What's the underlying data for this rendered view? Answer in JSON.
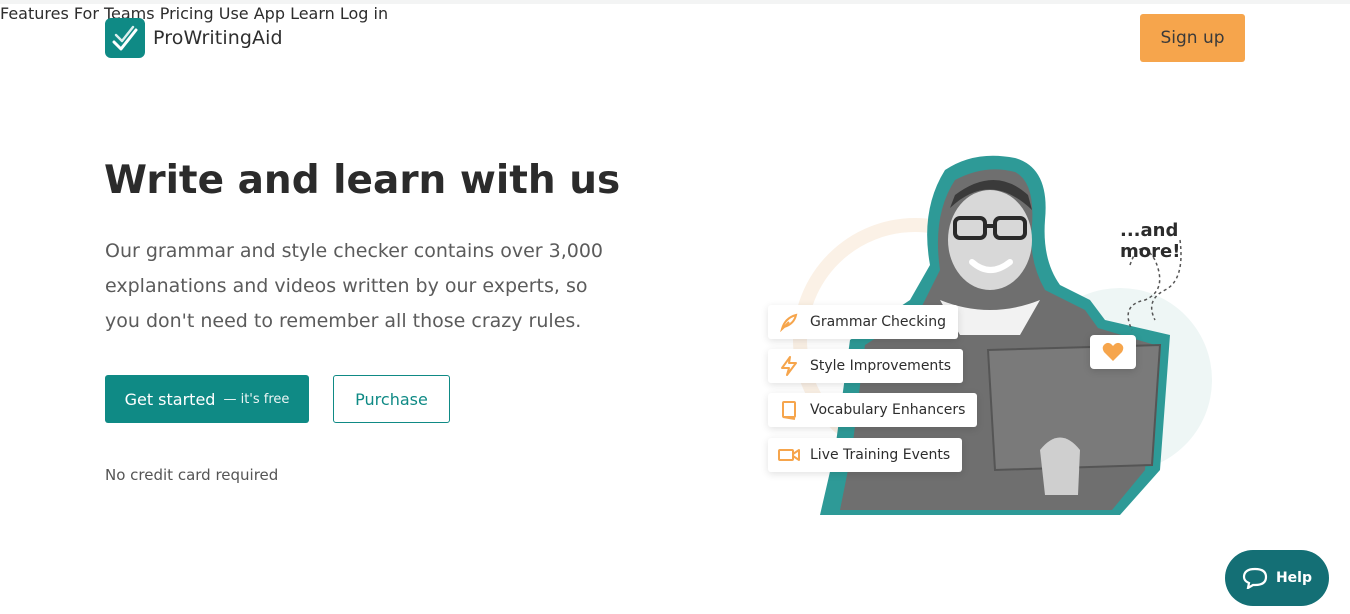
{
  "brand": {
    "name": "ProWritingAid",
    "color": "#0f8a85",
    "accent": "#f6a54c"
  },
  "nav": {
    "items": [
      "Features",
      "For Teams",
      "Pricing",
      "Use App",
      "Learn",
      "Log in"
    ],
    "signup_label": "Sign up"
  },
  "hero": {
    "title": "Write and learn with us",
    "text": "Our grammar and style checker contains over 3,000 explanations and videos written by our experts, so you don't need to remember all those crazy rules.",
    "cta_primary": "Get started",
    "cta_primary_suffix": "— it's free",
    "cta_secondary": "Purchase",
    "note": "No credit card required"
  },
  "illustration": {
    "more_label": "...and more!",
    "features": [
      {
        "label": "Grammar Checking",
        "icon": "quill-icon"
      },
      {
        "label": "Style Improvements",
        "icon": "lightning-icon"
      },
      {
        "label": "Vocabulary Enhancers",
        "icon": "book-icon"
      },
      {
        "label": "Live Training Events",
        "icon": "video-camera-icon"
      }
    ],
    "heart_icon": "heart-icon"
  },
  "help": {
    "label": "Help",
    "icon": "chat-bubble-icon"
  }
}
